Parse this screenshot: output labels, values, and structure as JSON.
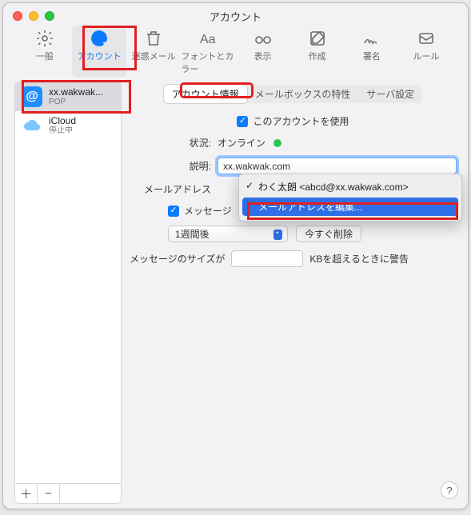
{
  "window": {
    "title": "アカウント"
  },
  "toolbar": {
    "items": [
      {
        "id": "general",
        "label": "一般"
      },
      {
        "id": "accounts",
        "label": "アカウント"
      },
      {
        "id": "junk",
        "label": "迷惑メール"
      },
      {
        "id": "fonts",
        "label": "フォントとカラー"
      },
      {
        "id": "viewing",
        "label": "表示"
      },
      {
        "id": "compose",
        "label": "作成"
      },
      {
        "id": "sign",
        "label": "署名"
      },
      {
        "id": "rules",
        "label": "ルール"
      }
    ]
  },
  "sidebar": {
    "items": [
      {
        "name": "xx.wakwak...",
        "sub": "POP"
      },
      {
        "name": "iCloud",
        "sub": "停止中"
      }
    ],
    "add": "＋",
    "remove": "−"
  },
  "tabs": {
    "items": [
      {
        "id": "info",
        "label": "アカウント情報"
      },
      {
        "id": "boxes",
        "label": "メールボックスの特性"
      },
      {
        "id": "server",
        "label": "サーバ設定"
      }
    ]
  },
  "form": {
    "enable_label": "このアカウントを使用",
    "status_label": "状況:",
    "status_value": "オンライン",
    "desc_label": "説明:",
    "desc_value": "xx.wakwak.com",
    "email_label": "メールアドレス",
    "msg_checkbox_prefix": "メッセージ",
    "retention_select": "1週間後",
    "delete_now_btn": "今すぐ削除",
    "size_label": "メッセージのサイズが",
    "size_unit": "KBを超えるときに警告"
  },
  "dropdown": {
    "current": "わく太朗 <abcd@xx.wakwak.com>",
    "edit": "メールアドレスを編集..."
  },
  "help": "?"
}
